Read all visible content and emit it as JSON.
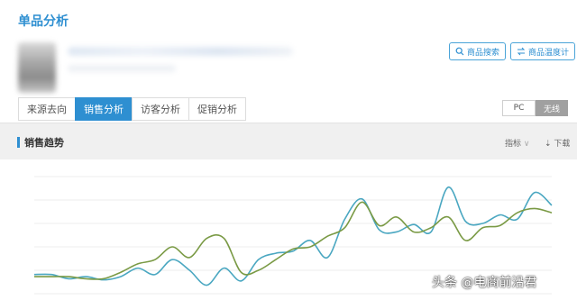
{
  "page": {
    "title": "单品分析"
  },
  "header": {
    "buttons": [
      {
        "label": "商品搜索",
        "icon": "search-icon"
      },
      {
        "label": "商品温度计",
        "icon": "exchange-icon"
      }
    ]
  },
  "tabs": [
    {
      "label": "来源去向",
      "active": false
    },
    {
      "label": "销售分析",
      "active": true
    },
    {
      "label": "访客分析",
      "active": false
    },
    {
      "label": "促销分析",
      "active": false
    }
  ],
  "device_toggle": {
    "options": [
      "PC",
      "无线"
    ],
    "selected": "无线"
  },
  "section": {
    "title": "销售趋势",
    "indicator_label": "指标",
    "download_label": "下载"
  },
  "colors": {
    "accent": "#2e8fd1",
    "series_blue": "#4aa7c1",
    "series_green": "#7a9a45"
  },
  "chart_data": {
    "type": "line",
    "x": [
      0,
      1,
      2,
      3,
      4,
      5,
      6,
      7,
      8,
      9,
      10,
      11,
      12,
      13,
      14,
      15,
      16,
      17,
      18,
      19,
      20,
      21,
      22,
      23,
      24,
      25,
      26,
      27,
      28,
      29,
      30
    ],
    "series": [
      {
        "values": [
          8,
          8,
          4,
          6,
          3,
          6,
          14,
          8,
          22,
          12,
          -2,
          14,
          2,
          22,
          28,
          30,
          40,
          24,
          60,
          79,
          50,
          48,
          55,
          48,
          90,
          58,
          56,
          64,
          60,
          85,
          73
        ]
      },
      {
        "values": [
          6,
          6,
          6,
          4,
          4,
          10,
          18,
          22,
          34,
          24,
          42,
          42,
          10,
          12,
          22,
          32,
          34,
          44,
          52,
          76,
          54,
          62,
          48,
          52,
          62,
          40,
          52,
          54,
          66,
          70,
          66
        ]
      }
    ]
  },
  "watermark": "头条 @电商前沿君"
}
